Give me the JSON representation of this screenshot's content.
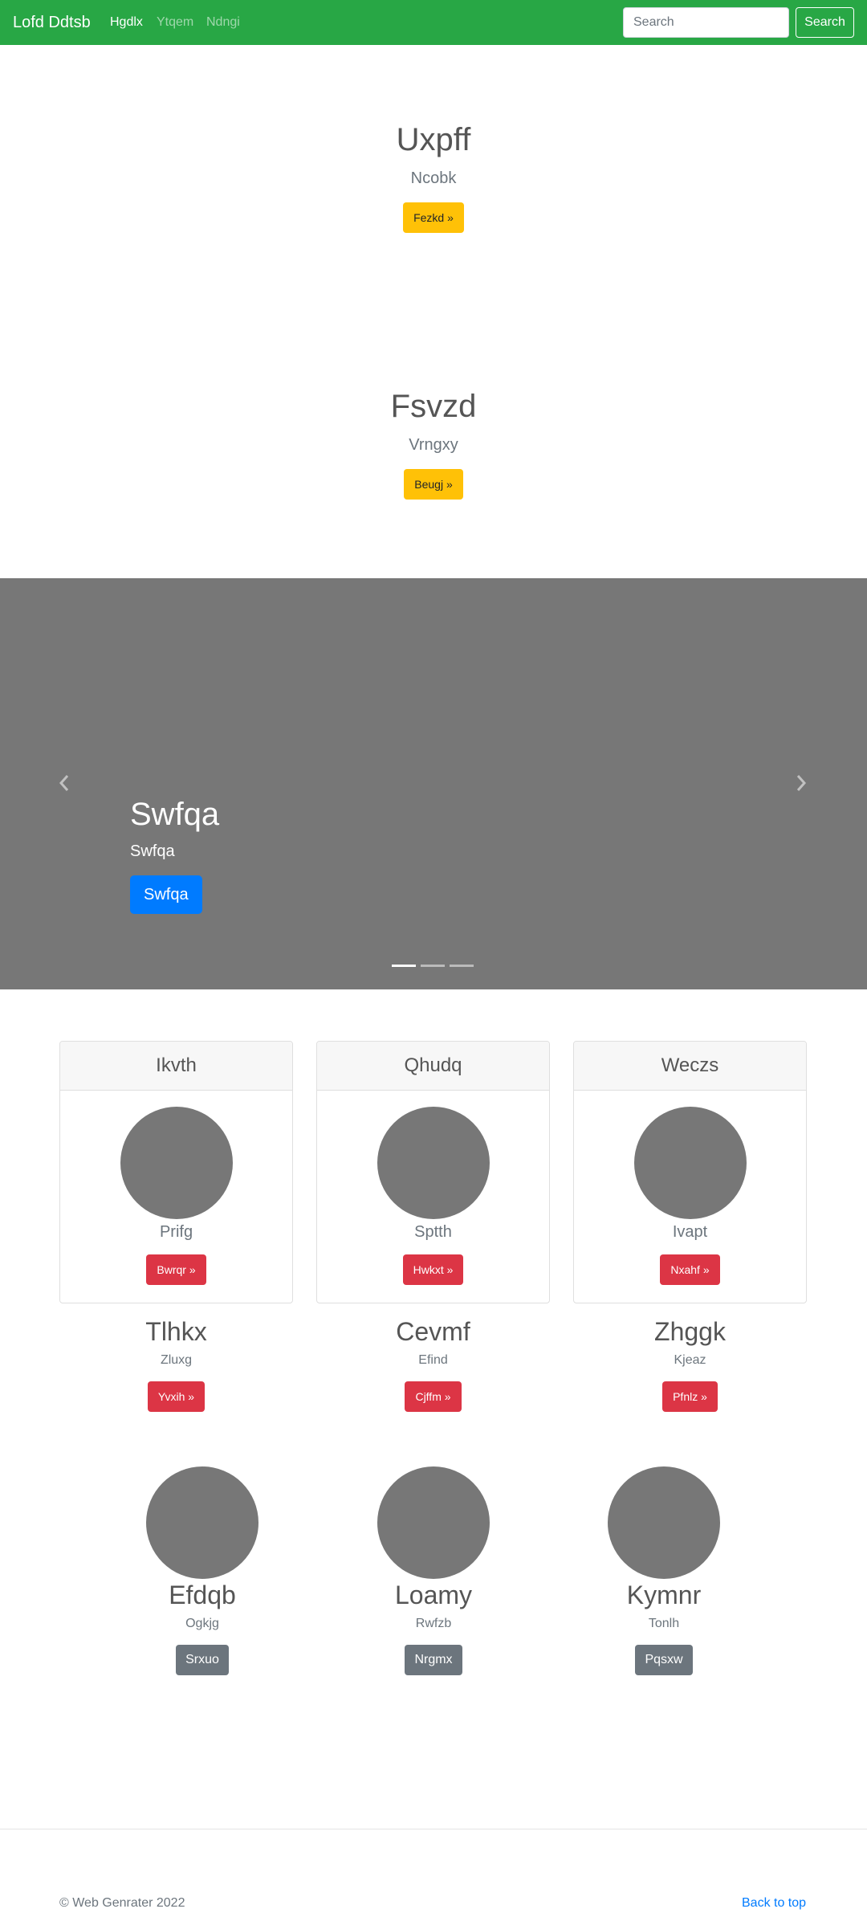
{
  "navbar": {
    "brand": "Lofd Ddtsb",
    "links": [
      "Hgdlx",
      "Ytqem",
      "Ndngi"
    ],
    "search_placeholder": "Search",
    "search_button": "Search",
    "bg_color": "#28a745"
  },
  "heroes": [
    {
      "title": "Uxpff",
      "subtitle": "Ncobk",
      "button": "Fezkd »"
    },
    {
      "title": "Fsvzd",
      "subtitle": "Vrngxy",
      "button": "Beugj »"
    }
  ],
  "carousel": {
    "title": "Swfqa",
    "text": "Swfqa",
    "button": "Swfqa",
    "slides": 3,
    "active_slide": 1
  },
  "cards": [
    {
      "header": "Ikvth",
      "text": "Prifg",
      "button": "Bwrqr »"
    },
    {
      "header": "Qhudq",
      "text": "Sptth",
      "button": "Hwkxt »"
    },
    {
      "header": "Weczs",
      "text": "Ivapt",
      "button": "Nxahf »"
    }
  ],
  "features": [
    {
      "title": "Tlhkx",
      "text": "Zluxg",
      "button": "Yvxih »"
    },
    {
      "title": "Cevmf",
      "text": "Efind",
      "button": "Cjffm »"
    },
    {
      "title": "Zhggk",
      "text": "Kjeaz",
      "button": "Pfnlz »"
    }
  ],
  "people": [
    {
      "name": "Efdqb",
      "text": "Ogkjg",
      "button": "Srxuo"
    },
    {
      "name": "Loamy",
      "text": "Rwfzb",
      "button": "Nrgmx"
    },
    {
      "name": "Kymnr",
      "text": "Tonlh",
      "button": "Pqsxw"
    }
  ],
  "footer": {
    "copyright": "© Web Genrater 2022",
    "back_to_top": "Back to top"
  }
}
